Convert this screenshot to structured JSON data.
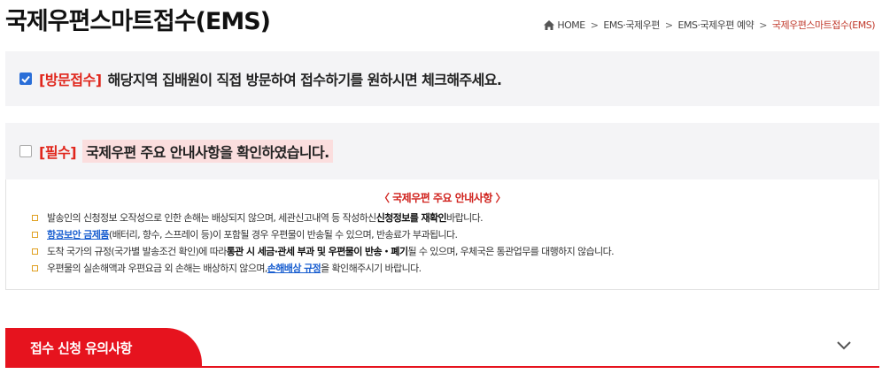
{
  "page_title": "국제우편스마트접수(EMS)",
  "breadcrumb": {
    "home": "HOME",
    "items": [
      "EMS·국제우편",
      "EMS·국제우편 예약"
    ],
    "current": "국제우편스마트접수(EMS)",
    "separator": ">"
  },
  "visit_option": {
    "checked": true,
    "tag": "[방문접수]",
    "text": "해당지역 집배원이 직접 방문하여 접수하기를 원하시면 체크해주세요."
  },
  "required_option": {
    "checked": false,
    "tag": "[필수]",
    "text": "국제우편 주요 안내사항을 확인하였습니다."
  },
  "notice": {
    "title": "〈 국제우편 주요 안내사항 〉",
    "items": {
      "item1_a": "발송인의 신청정보 오작성으로 인한 손해는 배상되지 않으며, 세관신고내역 등 작성하신 ",
      "item1_b": "신청정보를 재확인",
      "item1_c": " 바랍니다.",
      "item2_link": "항공보안 금제품",
      "item2_b": "(배터리, 향수, 스프레이 등)이 포함될 경우 우편물이 반송될 수 있으며, 반송료가 부과됩니다.",
      "item3_a": "도착 국가의 규정(국가별 발송조건 확인)에 따라 ",
      "item3_b": "통관 시 세금·관세 부과 및 우편물이 반송・폐기",
      "item3_c": "될 수 있으며, 우체국은 통관업무를 대행하지 않습니다.",
      "item4_a": "우편물의 실손해액과 우편요금 외 손해는 배상하지 않으며, ",
      "item4_link": "손해배상 규정",
      "item4_c": "을 확인해주시기 바랍니다."
    }
  },
  "accordion": {
    "label": "접수 신청 유의사항",
    "icon": "chevron-down-icon"
  },
  "colors": {
    "accent_red": "#e6131e",
    "checkbox_blue": "#2a6ed8",
    "link_blue": "#1a5fd0",
    "bullet_orange": "#e0a020"
  }
}
